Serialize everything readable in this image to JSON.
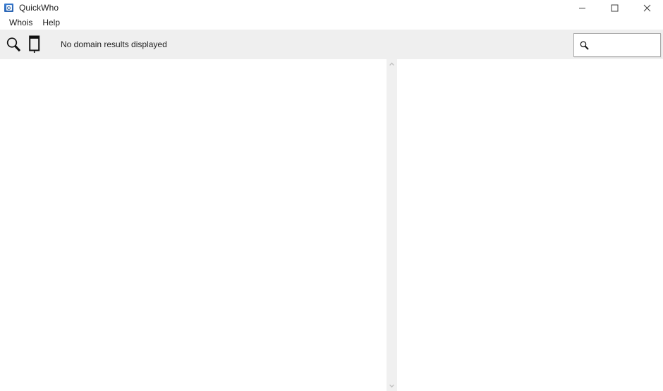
{
  "window": {
    "title": "QuickWho",
    "icon": "app-icon",
    "controls": {
      "minimize": "minimize-icon",
      "maximize": "maximize-icon",
      "close": "close-icon"
    }
  },
  "menubar": {
    "items": [
      {
        "label": "Whois"
      },
      {
        "label": "Help"
      }
    ]
  },
  "toolbar": {
    "buttons": [
      {
        "name": "lookup-button",
        "icon": "magnifier-icon"
      },
      {
        "name": "book-button",
        "icon": "book-icon"
      }
    ],
    "status_text": "No domain results displayed",
    "search": {
      "icon": "search-icon",
      "value": "",
      "placeholder": ""
    }
  },
  "content": {
    "left_pane": {
      "text": ""
    },
    "right_pane": {
      "text": ""
    },
    "scrollbar": {
      "up_arrow": "chevron-up-icon",
      "down_arrow": "chevron-down-icon"
    }
  },
  "colors": {
    "toolbar_bg": "#efefef",
    "window_bg": "#ffffff",
    "scrollbar_bg": "#f0f0f0",
    "text": "#1d1d1d",
    "icon_accent": "#2f6cbe"
  }
}
